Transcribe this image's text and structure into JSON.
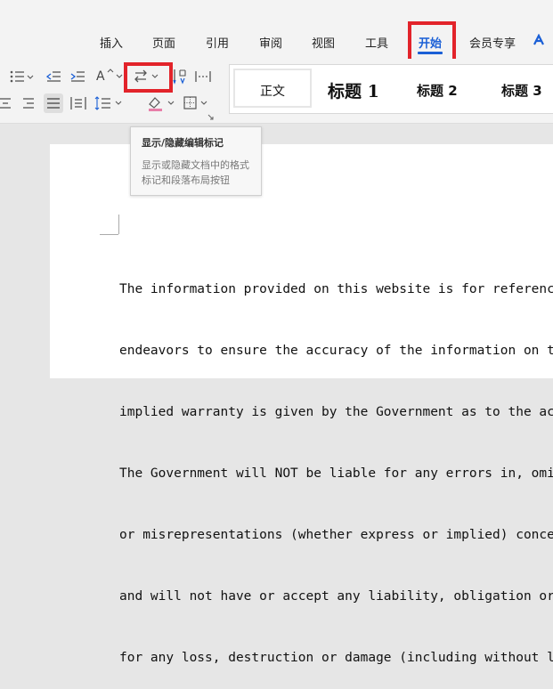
{
  "menu": {
    "insert": "插入",
    "page": "页面",
    "references": "引用",
    "review": "审阅",
    "view": "视图",
    "tools": "工具",
    "home": "开始",
    "member": "会员专享"
  },
  "ribbon": {
    "font_effect_glyph": "A",
    "styles": {
      "normal": "正文",
      "heading1": "标题 1",
      "heading2": "标题 2",
      "heading3": "标题 3"
    }
  },
  "tooltip": {
    "title": "显示/隐藏编辑标记",
    "body": "显示或隐藏文档中的格式标记和段落布局按钮"
  },
  "document": {
    "lines": [
      "The information provided on this website is for reference",
      "endeavors to ensure the accuracy of the information on t",
      "implied warranty is given by the Government as to the ac",
      "The Government will NOT be liable for any errors in, omiss",
      "or misrepresentations (whether express or implied) concer",
      "and will not have or accept any liability, obligation or",
      "for any loss, destruction or damage (including without lim"
    ]
  },
  "colors": {
    "accent": "#1a5fd6",
    "highlight_border": "#e2232a"
  }
}
